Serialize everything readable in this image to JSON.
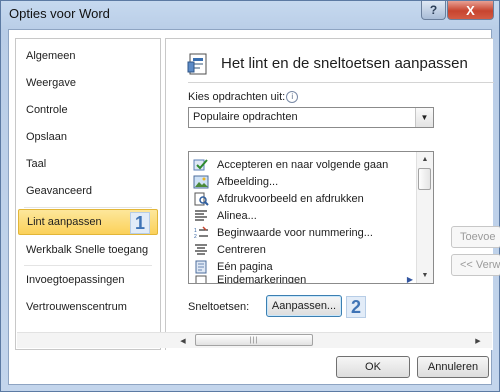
{
  "window": {
    "title": "Opties voor Word",
    "help_glyph": "?",
    "close_glyph": "X"
  },
  "sidebar": {
    "items": [
      {
        "label": "Algemeen"
      },
      {
        "label": "Weergave"
      },
      {
        "label": "Controle"
      },
      {
        "label": "Opslaan"
      },
      {
        "label": "Taal"
      },
      {
        "label": "Geavanceerd"
      },
      {
        "label": "Lint aanpassen",
        "active": true
      },
      {
        "label": "Werkbalk Snelle toegang"
      },
      {
        "label": "Invoegtoepassingen"
      },
      {
        "label": "Vertrouwenscentrum"
      }
    ],
    "callout_1": "1"
  },
  "main": {
    "heading": "Het lint en de sneltoetsen aanpassen",
    "kies_label": "Kies opdrachten uit:",
    "info_glyph": "i",
    "select_value": "Populaire opdrachten",
    "commands": [
      {
        "label": "Accepteren en naar volgende gaan",
        "icon": "accept-icon"
      },
      {
        "label": "Afbeelding...",
        "icon": "picture-icon"
      },
      {
        "label": "Afdrukvoorbeeld en afdrukken",
        "icon": "print-preview-icon"
      },
      {
        "label": "Alinea...",
        "icon": "paragraph-icon"
      },
      {
        "label": "Beginwaarde voor nummering...",
        "icon": "numbering-icon"
      },
      {
        "label": "Centreren",
        "icon": "center-align-icon"
      },
      {
        "label": "Eén pagina",
        "icon": "one-page-icon"
      },
      {
        "label": "Eindemarkeringen",
        "icon": "endnote-icon"
      }
    ],
    "add_button": "Toevoe",
    "remove_button": "<< Verw",
    "shortcut_label": "Sneltoetsen:",
    "aanpassen_button": "Aanpassen...",
    "callout_2": "2"
  },
  "footer": {
    "ok_button": "OK",
    "cancel_button": "Annuleren"
  },
  "colors": {
    "active_item": "#fbd15a",
    "callout_text": "#3f74b6",
    "frame": "#c6d9ef"
  }
}
